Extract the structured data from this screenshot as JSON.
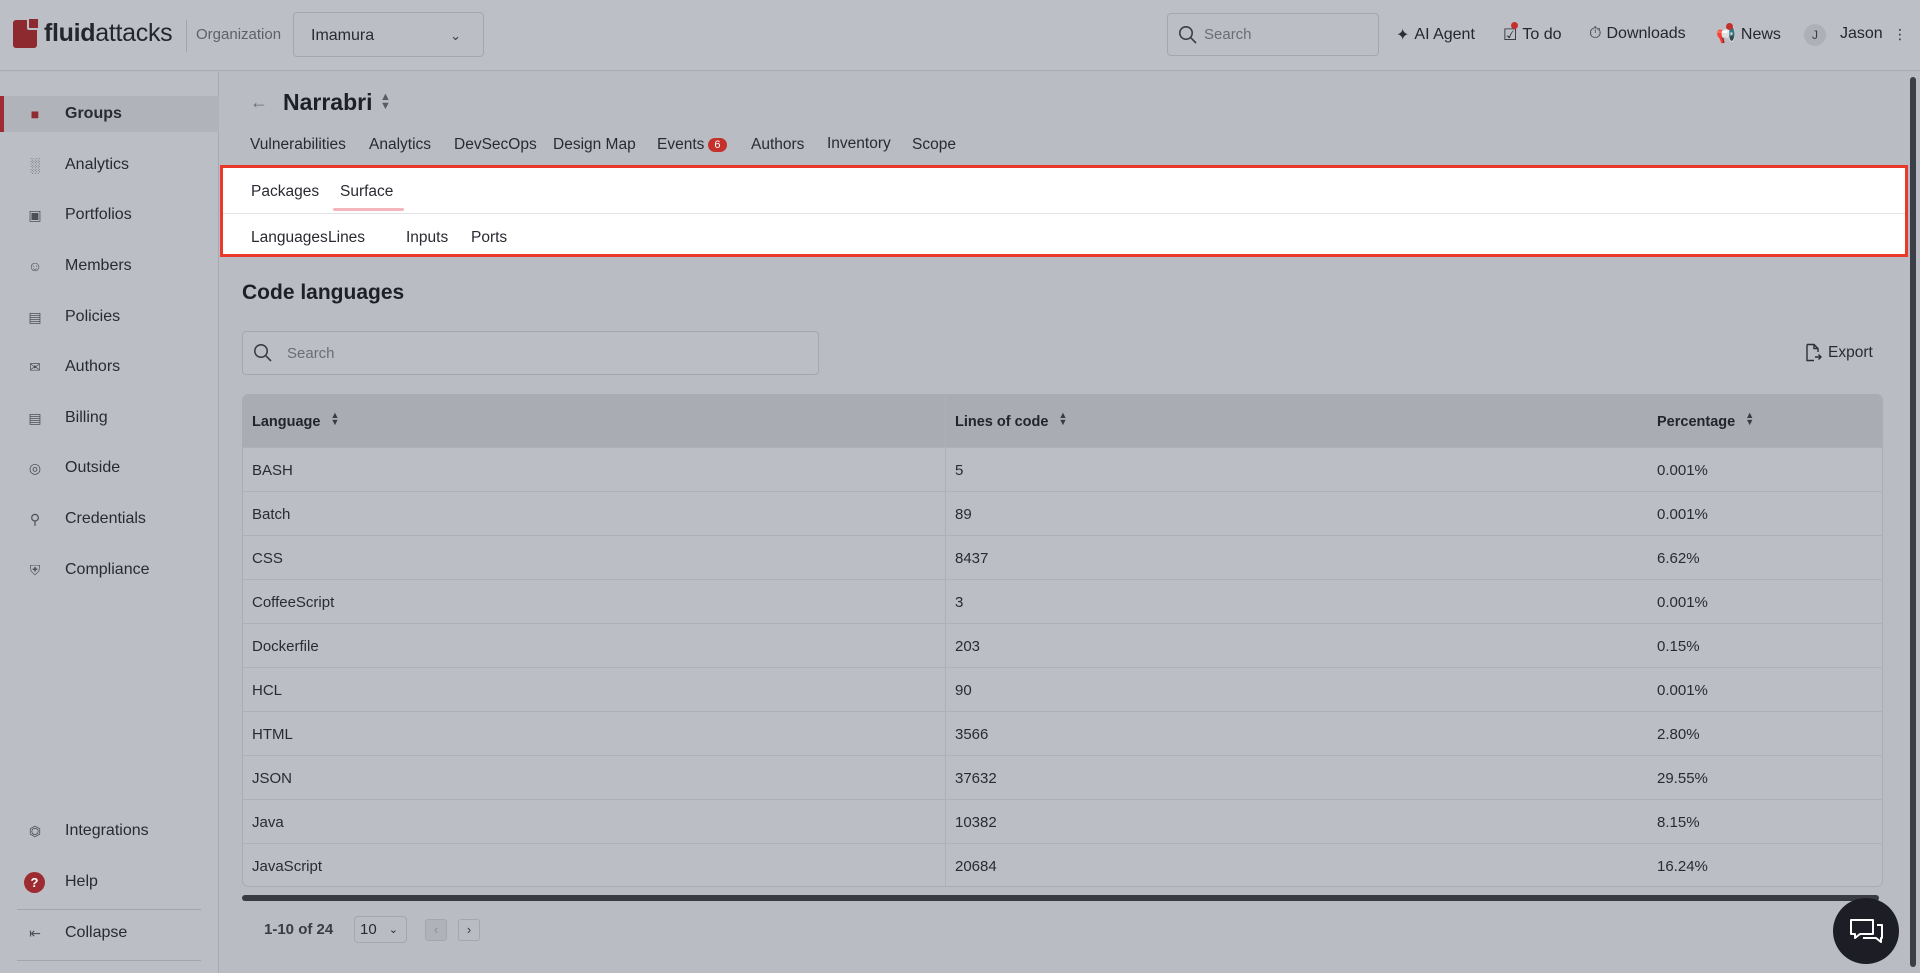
{
  "app": {
    "logo_bold": "fluid",
    "logo_rest": "attacks",
    "org_label": "Organization",
    "org_value": "Imamura",
    "search_placeholder": "Search",
    "links": {
      "ai_agent": "AI Agent",
      "todo": "To do",
      "downloads": "Downloads",
      "news": "News"
    },
    "user_initial": "J",
    "user_name": "Jason"
  },
  "sidebar": {
    "items": [
      {
        "label": "Groups",
        "icon": "folder-icon"
      },
      {
        "label": "Analytics",
        "icon": "bar-chart-icon"
      },
      {
        "label": "Portfolios",
        "icon": "briefcase-icon"
      },
      {
        "label": "Members",
        "icon": "user-plus-icon"
      },
      {
        "label": "Policies",
        "icon": "policy-icon"
      },
      {
        "label": "Authors",
        "icon": "mail-icon"
      },
      {
        "label": "Billing",
        "icon": "billing-icon"
      },
      {
        "label": "Outside",
        "icon": "outside-icon"
      },
      {
        "label": "Credentials",
        "icon": "key-icon"
      },
      {
        "label": "Compliance",
        "icon": "shield-check-icon"
      }
    ],
    "bottom": {
      "integrations": "Integrations",
      "help": "Help",
      "help_glyph": "?",
      "collapse": "Collapse"
    }
  },
  "group": {
    "title": "Narrabri",
    "tabs": {
      "vulnerabilities": "Vulnerabilities",
      "analytics": "Analytics",
      "devsecops": "DevSecOps",
      "design_map": "Design Map",
      "events": "Events",
      "events_count": "6",
      "authors": "Authors",
      "inventory": "Inventory",
      "scope": "Scope"
    },
    "subtabs": {
      "packages": "Packages",
      "surface": "Surface"
    },
    "subsubtabs": {
      "languages": "Languages",
      "lines": "Lines",
      "inputs": "Inputs",
      "ports": "Ports"
    }
  },
  "section": {
    "title": "Code languages",
    "search_placeholder": "Search",
    "export": "Export"
  },
  "table": {
    "headers": {
      "language": "Language",
      "lines": "Lines of code",
      "percentage": "Percentage"
    },
    "rows": [
      {
        "language": "BASH",
        "lines": "5",
        "percentage": "0.001%"
      },
      {
        "language": "Batch",
        "lines": "89",
        "percentage": "0.001%"
      },
      {
        "language": "CSS",
        "lines": "8437",
        "percentage": "6.62%"
      },
      {
        "language": "CoffeeScript",
        "lines": "3",
        "percentage": "0.001%"
      },
      {
        "language": "Dockerfile",
        "lines": "203",
        "percentage": "0.15%"
      },
      {
        "language": "HCL",
        "lines": "90",
        "percentage": "0.001%"
      },
      {
        "language": "HTML",
        "lines": "3566",
        "percentage": "2.80%"
      },
      {
        "language": "JSON",
        "lines": "37632",
        "percentage": "29.55%"
      },
      {
        "language": "Java",
        "lines": "10382",
        "percentage": "8.15%"
      },
      {
        "language": "JavaScript",
        "lines": "20684",
        "percentage": "16.24%"
      }
    ]
  },
  "pager": {
    "info": "1-10 of 24",
    "page_size": "10"
  },
  "colors": {
    "brand": "#9e2b31",
    "highlight": "#e8392a",
    "badge": "#c4302b"
  }
}
